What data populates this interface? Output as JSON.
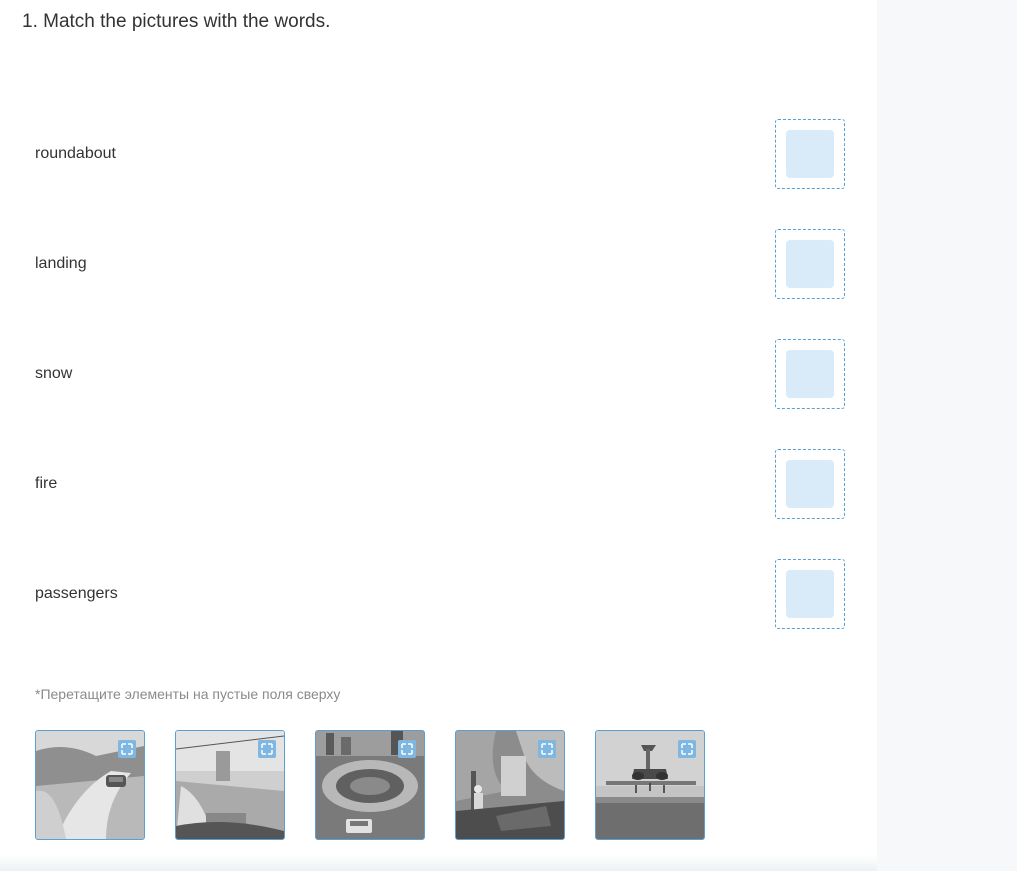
{
  "exercise": {
    "title": "1. Match the pictures with the words."
  },
  "words": [
    {
      "label": "roundabout"
    },
    {
      "label": "landing"
    },
    {
      "label": "snow"
    },
    {
      "label": "fire"
    },
    {
      "label": "passengers"
    }
  ],
  "hint": "*Перетащите элементы на пустые поля сверху",
  "pictures": [
    {
      "icon": "snowy-road-car-image"
    },
    {
      "icon": "car-interior-passengers-image"
    },
    {
      "icon": "roundabout-aerial-image"
    },
    {
      "icon": "fire-firefighter-image"
    },
    {
      "icon": "airplane-landing-image"
    }
  ],
  "colors": {
    "dropzone_border": "#5a9fd4",
    "dropzone_fill": "#d9eaf8",
    "expand_button": "#7fb7e3"
  }
}
